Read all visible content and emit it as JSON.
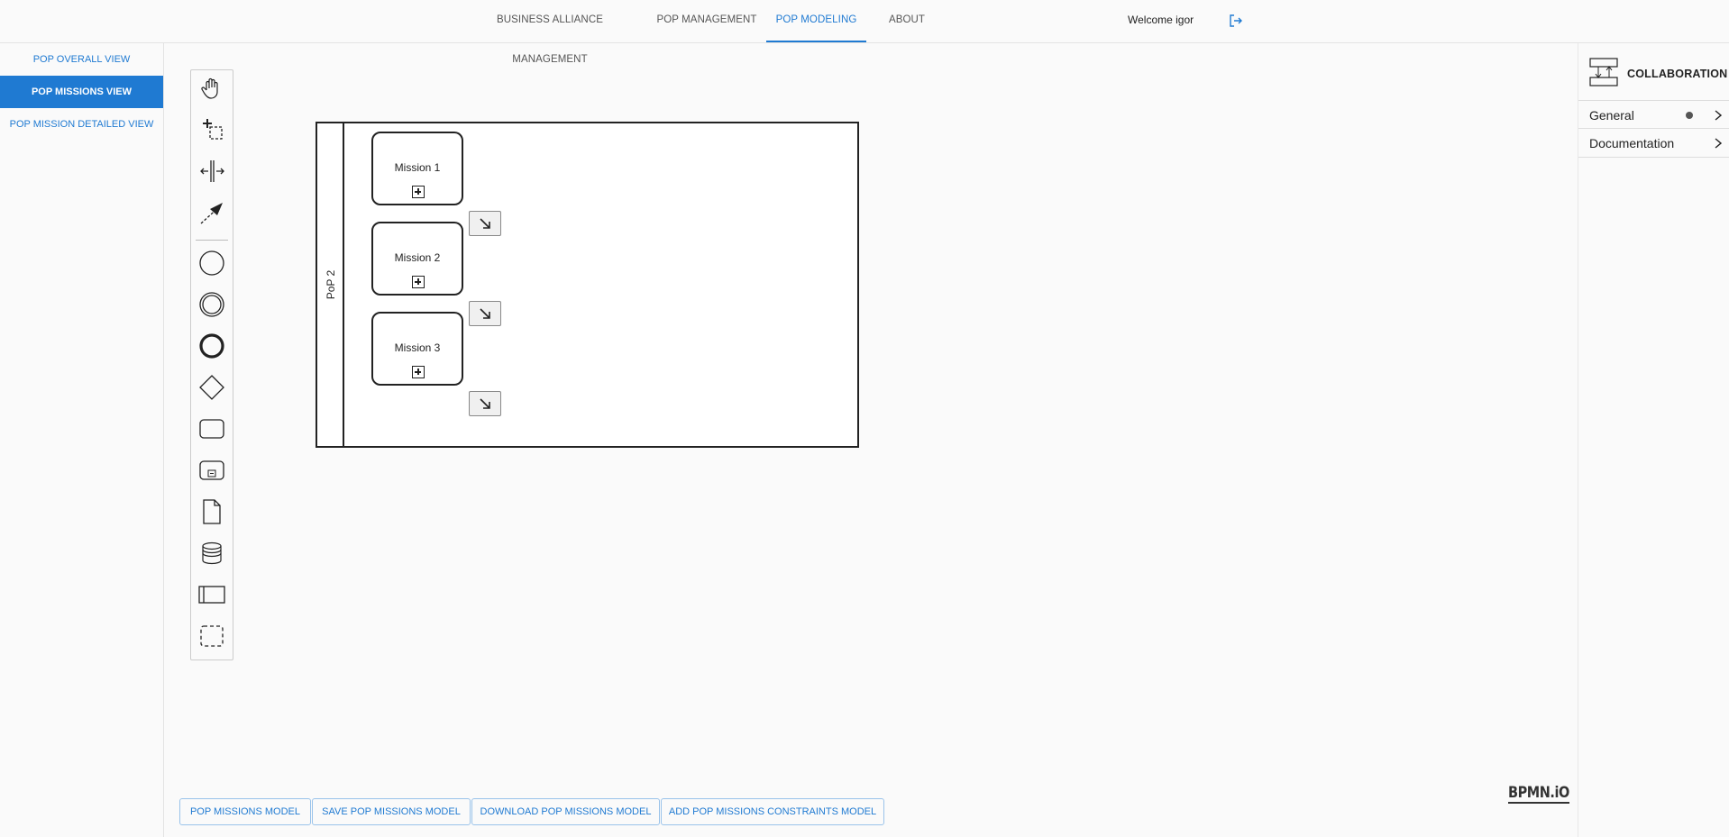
{
  "nav": {
    "tabs": [
      {
        "label": "BUSINESS ALLIANCE MANAGEMENT"
      },
      {
        "label": "POP MANAGEMENT"
      },
      {
        "label": "POP MODELING"
      },
      {
        "label": "ABOUT"
      }
    ],
    "active_tab": "POP MODELING",
    "welcome": "Welcome igor",
    "logout_icon": "logout-icon"
  },
  "sidebar": {
    "items": [
      {
        "label": "POP OVERALL VIEW"
      },
      {
        "label": "POP MISSIONS VIEW"
      },
      {
        "label": "POP MISSION DETAILED VIEW"
      }
    ],
    "active": "POP MISSIONS VIEW"
  },
  "palette": {
    "tools": [
      "hand-tool-icon",
      "lasso-tool-icon",
      "space-tool-icon",
      "global-connect-icon",
      "start-event-icon",
      "intermediate-event-icon",
      "end-event-icon",
      "gateway-icon",
      "task-icon",
      "subprocess-icon",
      "data-object-icon",
      "data-store-icon",
      "pool-icon",
      "group-icon"
    ]
  },
  "diagram": {
    "pool_label": "PoP 2",
    "missions": [
      {
        "label": "Mission 1"
      },
      {
        "label": "Mission 2"
      },
      {
        "label": "Mission 3"
      }
    ]
  },
  "properties": {
    "title": "COLLABORATION",
    "groups": [
      {
        "label": "General"
      },
      {
        "label": "Documentation"
      }
    ]
  },
  "buttons": {
    "missions_model": "POP MISSIONS MODEL",
    "save": "SAVE POP MISSIONS MODEL",
    "download": "DOWNLOAD POP MISSIONS MODEL",
    "constraints": "ADD POP MISSIONS CONSTRAINTS MODEL"
  },
  "brand": "BPMN.iO",
  "colors": {
    "accent": "#1f7ad2",
    "background": "#fafafa"
  }
}
